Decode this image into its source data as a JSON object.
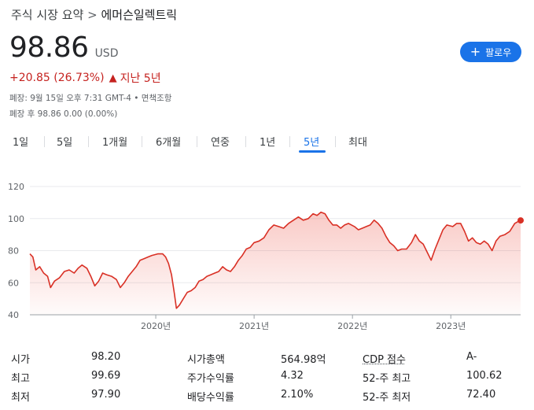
{
  "breadcrumb": {
    "root": "주식 시장 요약",
    "separator": ">",
    "current": "에머슨일렉트릭"
  },
  "quote": {
    "price": "98.86",
    "currency": "USD",
    "change": "+20.85 (26.73%)",
    "period": "지난 5년",
    "change_color": "#c5221f"
  },
  "follow_button": {
    "label": "팔로우",
    "icon": "plus-icon",
    "color": "#1a73e8"
  },
  "notes": {
    "closed": "폐장: 9월 15일 오후 7:31 GMT-4 • 면책조항",
    "after_hours": "폐장 후 98.86 0.00 (0.00%)"
  },
  "tabs": [
    {
      "label": "1일",
      "active": false
    },
    {
      "label": "5일",
      "active": false
    },
    {
      "label": "1개월",
      "active": false
    },
    {
      "label": "6개월",
      "active": false
    },
    {
      "label": "연중",
      "active": false
    },
    {
      "label": "1년",
      "active": false
    },
    {
      "label": "5년",
      "active": true
    },
    {
      "label": "최대",
      "active": false
    }
  ],
  "chart_data": {
    "type": "area",
    "y_ticks": [
      "120",
      "100",
      "80",
      "60",
      "40"
    ],
    "ylim": [
      40,
      120
    ],
    "x_ticks": [
      {
        "label": "2020년",
        "t": 2020.0
      },
      {
        "label": "2021년",
        "t": 2021.0
      },
      {
        "label": "2022년",
        "t": 2022.0
      },
      {
        "label": "2023년",
        "t": 2023.0
      }
    ],
    "xlim": [
      2018.72,
      2023.71
    ],
    "line_color": "#d93025",
    "series": [
      {
        "points": [
          [
            2018.72,
            78
          ],
          [
            2018.75,
            76
          ],
          [
            2018.78,
            68
          ],
          [
            2018.82,
            70
          ],
          [
            2018.86,
            66
          ],
          [
            2018.9,
            64
          ],
          [
            2018.93,
            57
          ],
          [
            2018.97,
            61
          ],
          [
            2019.02,
            63
          ],
          [
            2019.07,
            67
          ],
          [
            2019.12,
            68
          ],
          [
            2019.17,
            66
          ],
          [
            2019.21,
            69
          ],
          [
            2019.25,
            71
          ],
          [
            2019.3,
            69
          ],
          [
            2019.34,
            64
          ],
          [
            2019.38,
            58
          ],
          [
            2019.42,
            61
          ],
          [
            2019.46,
            66
          ],
          [
            2019.5,
            65
          ],
          [
            2019.55,
            64
          ],
          [
            2019.6,
            62
          ],
          [
            2019.64,
            57
          ],
          [
            2019.68,
            60
          ],
          [
            2019.72,
            64
          ],
          [
            2019.76,
            67
          ],
          [
            2019.8,
            70
          ],
          [
            2019.84,
            74
          ],
          [
            2019.88,
            75
          ],
          [
            2019.92,
            76
          ],
          [
            2019.96,
            77
          ],
          [
            2020.02,
            78
          ],
          [
            2020.07,
            78
          ],
          [
            2020.1,
            76
          ],
          [
            2020.13,
            72
          ],
          [
            2020.16,
            65
          ],
          [
            2020.19,
            53
          ],
          [
            2020.21,
            44
          ],
          [
            2020.24,
            46
          ],
          [
            2020.28,
            50
          ],
          [
            2020.32,
            54
          ],
          [
            2020.36,
            55
          ],
          [
            2020.4,
            57
          ],
          [
            2020.44,
            61
          ],
          [
            2020.48,
            62
          ],
          [
            2020.52,
            64
          ],
          [
            2020.56,
            65
          ],
          [
            2020.6,
            66
          ],
          [
            2020.64,
            67
          ],
          [
            2020.68,
            70
          ],
          [
            2020.72,
            68
          ],
          [
            2020.76,
            67
          ],
          [
            2020.8,
            70
          ],
          [
            2020.84,
            74
          ],
          [
            2020.88,
            77
          ],
          [
            2020.92,
            81
          ],
          [
            2020.96,
            82
          ],
          [
            2021.0,
            85
          ],
          [
            2021.05,
            86
          ],
          [
            2021.1,
            88
          ],
          [
            2021.15,
            93
          ],
          [
            2021.2,
            96
          ],
          [
            2021.25,
            95
          ],
          [
            2021.3,
            94
          ],
          [
            2021.35,
            97
          ],
          [
            2021.4,
            99
          ],
          [
            2021.45,
            101
          ],
          [
            2021.5,
            99
          ],
          [
            2021.55,
            100
          ],
          [
            2021.6,
            103
          ],
          [
            2021.64,
            102
          ],
          [
            2021.68,
            104
          ],
          [
            2021.72,
            103
          ],
          [
            2021.76,
            99
          ],
          [
            2021.8,
            96
          ],
          [
            2021.84,
            96
          ],
          [
            2021.88,
            94
          ],
          [
            2021.92,
            96
          ],
          [
            2021.96,
            97
          ],
          [
            2022.02,
            95
          ],
          [
            2022.06,
            93
          ],
          [
            2022.1,
            94
          ],
          [
            2022.14,
            95
          ],
          [
            2022.18,
            96
          ],
          [
            2022.22,
            99
          ],
          [
            2022.26,
            97
          ],
          [
            2022.3,
            94
          ],
          [
            2022.34,
            89
          ],
          [
            2022.38,
            85
          ],
          [
            2022.42,
            83
          ],
          [
            2022.46,
            80
          ],
          [
            2022.5,
            81
          ],
          [
            2022.55,
            81
          ],
          [
            2022.6,
            85
          ],
          [
            2022.64,
            90
          ],
          [
            2022.68,
            86
          ],
          [
            2022.72,
            84
          ],
          [
            2022.76,
            79
          ],
          [
            2022.8,
            74
          ],
          [
            2022.84,
            81
          ],
          [
            2022.88,
            87
          ],
          [
            2022.92,
            93
          ],
          [
            2022.96,
            96
          ],
          [
            2023.02,
            95
          ],
          [
            2023.06,
            97
          ],
          [
            2023.1,
            97
          ],
          [
            2023.14,
            92
          ],
          [
            2023.18,
            86
          ],
          [
            2023.22,
            88
          ],
          [
            2023.26,
            85
          ],
          [
            2023.3,
            84
          ],
          [
            2023.34,
            86
          ],
          [
            2023.38,
            84
          ],
          [
            2023.42,
            80
          ],
          [
            2023.46,
            86
          ],
          [
            2023.5,
            89
          ],
          [
            2023.55,
            90
          ],
          [
            2023.6,
            92
          ],
          [
            2023.65,
            97
          ],
          [
            2023.68,
            98
          ],
          [
            2023.71,
            98.86
          ]
        ]
      }
    ]
  },
  "stats": [
    {
      "label": "시가",
      "value": "98.20"
    },
    {
      "label": "최고",
      "value": "99.69"
    },
    {
      "label": "최저",
      "value": "97.90"
    },
    {
      "label": "시가총액",
      "value": "564.98억"
    },
    {
      "label": "주가수익률",
      "value": "4.32"
    },
    {
      "label": "배당수익률",
      "value": "2.10%"
    },
    {
      "label": "CDP 점수",
      "value": "A-"
    },
    {
      "label": "52-주 최고",
      "value": "100.62"
    },
    {
      "label": "52-주 최저",
      "value": "72.40"
    }
  ]
}
